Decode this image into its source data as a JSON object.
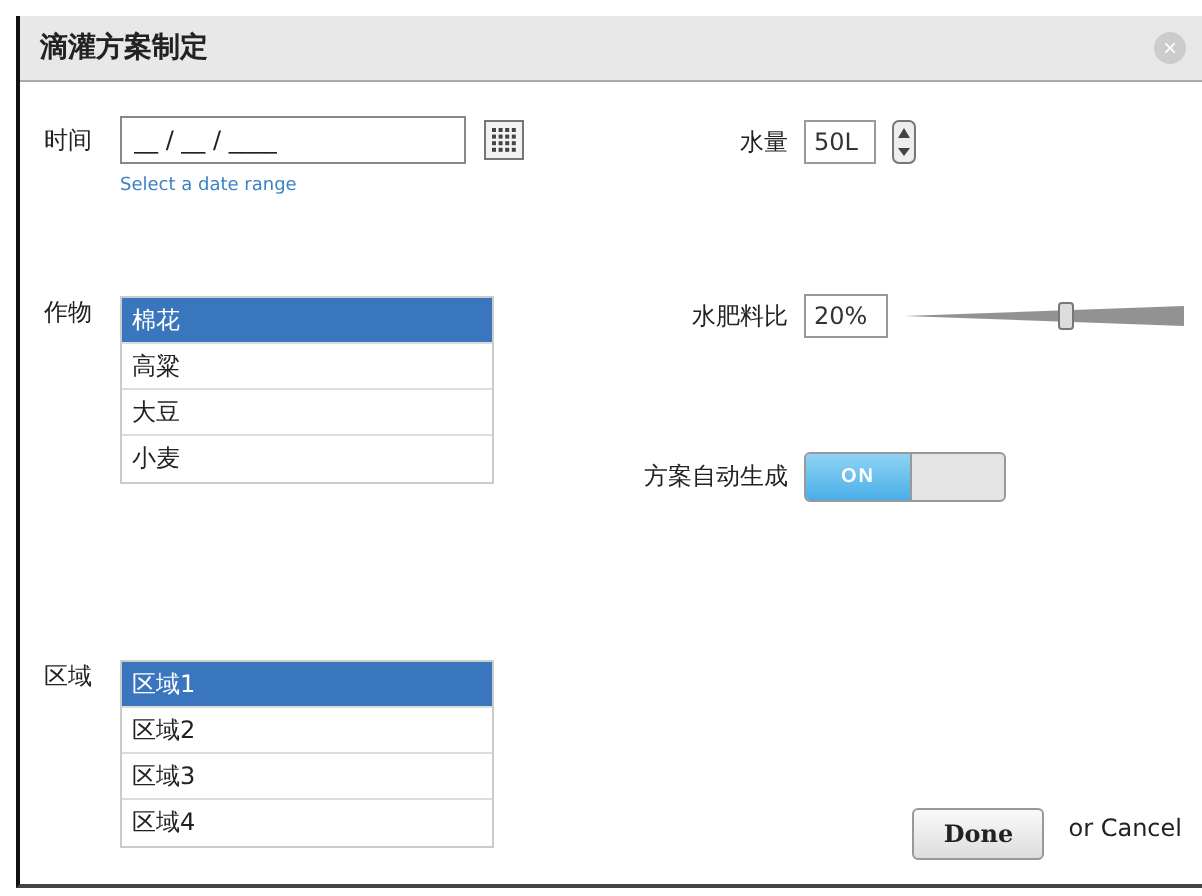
{
  "dialog": {
    "title": "滴灌方案制定",
    "close": "×"
  },
  "time": {
    "label": "时间",
    "placeholder": "__ / __ / ____",
    "hint": "Select a date range"
  },
  "crops": {
    "label": "作物",
    "items": [
      {
        "label": "棉花",
        "selected": true
      },
      {
        "label": "高粱",
        "selected": false
      },
      {
        "label": "大豆",
        "selected": false
      },
      {
        "label": "小麦",
        "selected": false
      }
    ]
  },
  "zones": {
    "label": "区域",
    "items": [
      {
        "label": "区域1",
        "selected": true
      },
      {
        "label": "区域2",
        "selected": false
      },
      {
        "label": "区域3",
        "selected": false
      },
      {
        "label": "区域4",
        "selected": false
      }
    ]
  },
  "water": {
    "label": "水量",
    "value": "50L"
  },
  "ratio": {
    "label": "水肥料比",
    "value": "20%",
    "level": 0.58
  },
  "auto": {
    "label": "方案自动生成",
    "on": true,
    "on_text": "ON"
  },
  "actions": {
    "done": "Done",
    "cancel": "or Cancel"
  }
}
